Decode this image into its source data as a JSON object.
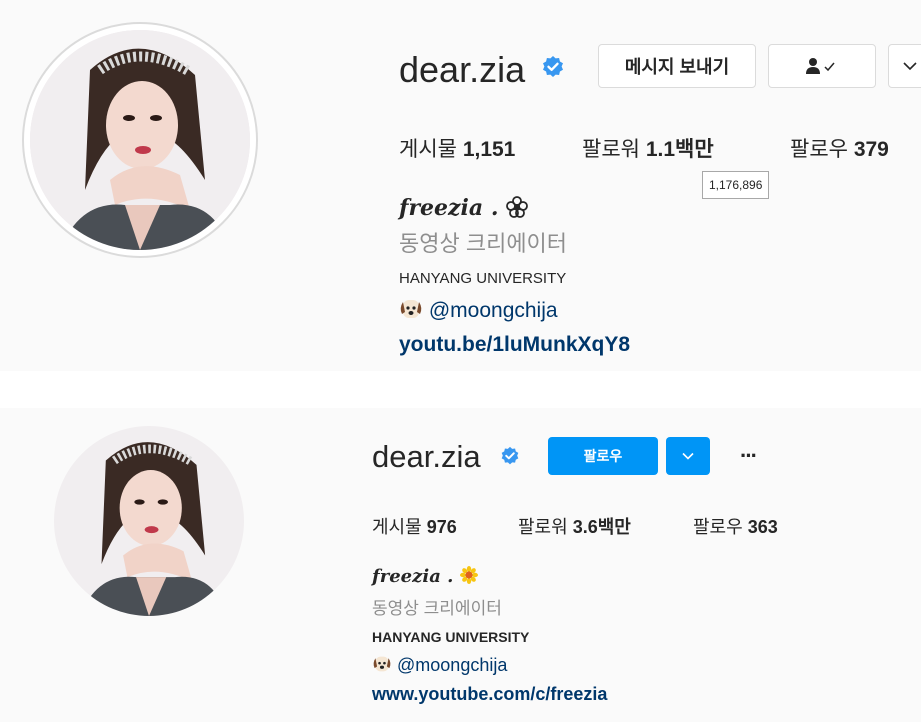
{
  "top": {
    "username": "dear.zia",
    "buttons": {
      "message": "메시지 보내기"
    },
    "stats": {
      "posts_label": "게시물",
      "posts_value": "1,151",
      "followers_label": "팔로워",
      "followers_value": "1.1백만",
      "following_label": "팔로우",
      "following_value": "379"
    },
    "tooltip": "1,176,896",
    "bio": {
      "name": "freezia .",
      "category": "동영상 크리에이터",
      "school": "HANYANG UNIVERSITY",
      "mention": "@moongchija",
      "link": "youtu.be/1luMunkXqY8"
    }
  },
  "bottom": {
    "username": "dear.zia",
    "buttons": {
      "follow": "팔로우",
      "more": "···"
    },
    "stats": {
      "posts_label": "게시물",
      "posts_value": "976",
      "followers_label": "팔로워",
      "followers_value": "3.6백만",
      "following_label": "팔로우",
      "following_value": "363"
    },
    "bio": {
      "name": "freezia .",
      "category": "동영상 크리에이터",
      "school": "HANYANG UNIVERSITY",
      "mention": "@moongchija",
      "link": "www.youtube.com/c/freezia"
    }
  },
  "icons": {
    "verified": "verified-badge-icon",
    "person_check": "person-check-icon",
    "chevron": "chevron-down-icon",
    "flower": "flower-icon",
    "sunflower": "sunflower-emoji-icon",
    "dog": "dog-emoji-icon"
  },
  "colors": {
    "accent": "#0095f6",
    "verified": "#3897f0",
    "link": "#00376b",
    "muted": "#8e8e8e"
  }
}
